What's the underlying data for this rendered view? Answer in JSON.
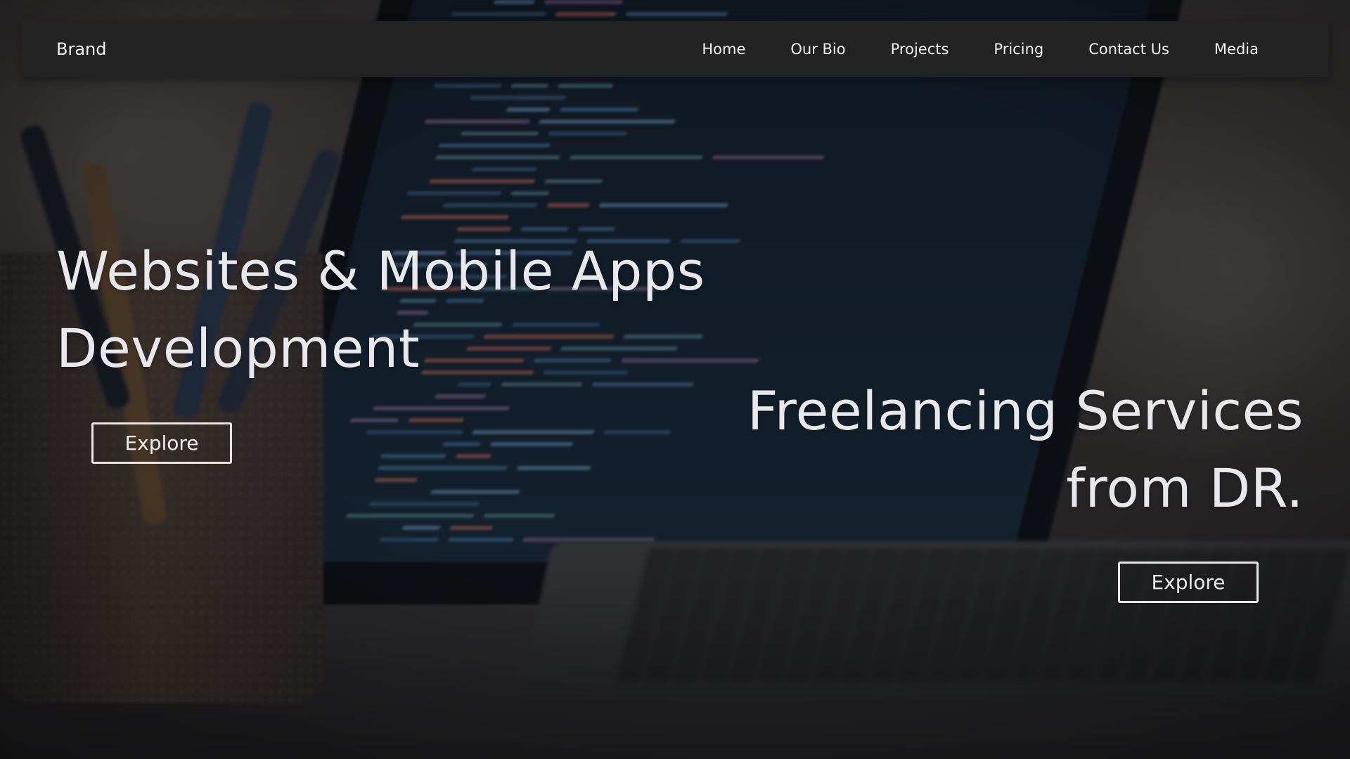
{
  "navbar": {
    "brand": "Brand",
    "links": [
      {
        "label": "Home"
      },
      {
        "label": "Our Bio"
      },
      {
        "label": "Projects"
      },
      {
        "label": "Pricing"
      },
      {
        "label": "Contact Us"
      },
      {
        "label": "Media"
      }
    ]
  },
  "hero": {
    "left": {
      "headline_line1": "Websites & Mobile Apps",
      "headline_line2": "Development",
      "button_label": "Explore"
    },
    "right": {
      "headline_line1": "Freelancing Services",
      "headline_line2": "from DR.",
      "button_label": "Explore"
    }
  },
  "colors": {
    "navbar_bg": "#232324",
    "text": "#ececec",
    "button_border": "#e6e6e6"
  }
}
